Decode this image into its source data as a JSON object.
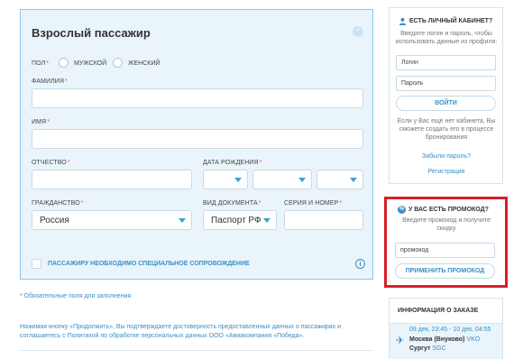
{
  "passenger": {
    "title": "Взрослый пассажир",
    "gender_label": "ПОЛ",
    "gender_male": "МУЖСКОЙ",
    "gender_female": "ЖЕНСКИЙ",
    "lastname_label": "ФАМИЛИЯ",
    "firstname_label": "ИМЯ",
    "middlename_label": "ОТЧЕСТВО",
    "birthdate_label": "ДАТА РОЖДЕНИЯ",
    "citizenship_label": "ГРАЖДАНСТВО",
    "citizenship_value": "Россия",
    "doc_type_label": "ВИД ДОКУМЕНТА",
    "doc_type_value": "Паспорт РФ",
    "doc_number_label": "СЕРИЯ И НОМЕР",
    "required_mark": "*",
    "escort_label": "ПАССАЖИРУ НЕОБХОДИМО СПЕЦИАЛЬНОЕ СОПРОВОЖДЕНИЕ",
    "info_glyph": "i"
  },
  "required_note": "* Обязательные поля для заполнения",
  "consent_text": "Нажимая кнопку «Продолжить», Вы подтверждаете достоверность предоставленных данных о пассажирах и соглашаетесь с Политикой по обработке персональных данных ООО «Авиакомпания «Победа».",
  "login": {
    "title": "ЕСТЬ ЛИЧНЫЙ КАБИНЕТ?",
    "hint": "Введите логин и пароль, чтобы использовать данные из профиля:",
    "login_placeholder": "Логин",
    "password_placeholder": "Пароль",
    "submit_label": "ВОЙТИ",
    "no_account_text": "Если у Вас еще нет кабинета, Вы сможете создать его в процессе бронирования",
    "forgot_link": "Забыли пароль?",
    "register_link": "Регистрация"
  },
  "promo": {
    "title": "У ВАС ЕСТЬ ПРОМОКОД?",
    "hint": "Введите промокод и получите скидку",
    "input_value": "промокод",
    "apply_label": "ПРИМЕНИТЬ ПРОМОКОД",
    "icon_glyph": "%"
  },
  "order": {
    "title": "ИНФОРМАЦИЯ О ЗАКАЗЕ",
    "dates": "09 дек, 23:45 - 10 дек, 04:55",
    "from_city": "Москва (Внуково)",
    "from_code": "VKO",
    "to_city": "Сургут",
    "to_code": "SGC"
  },
  "colors": {
    "accent": "#3a8fc8",
    "highlight": "#d91f2b",
    "card_bg": "#eaf4fb"
  }
}
